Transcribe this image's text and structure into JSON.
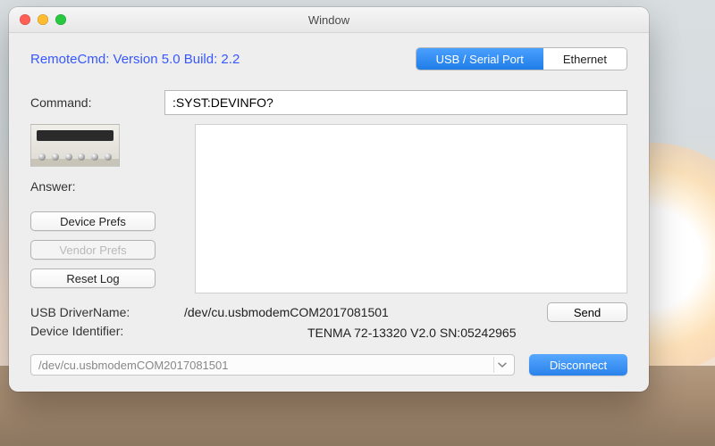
{
  "window": {
    "title": "Window"
  },
  "header": {
    "version_label": "RemoteCmd: Version 5.0 Build: 2.2",
    "tabs": {
      "usb": "USB / Serial Port",
      "ethernet": "Ethernet",
      "selected": "usb"
    }
  },
  "command": {
    "label": "Command:",
    "value": ":SYST:DEVINFO?"
  },
  "answer": {
    "label": "Answer:"
  },
  "buttons": {
    "device_prefs": "Device Prefs",
    "vendor_prefs": "Vendor Prefs",
    "reset_log": "Reset Log",
    "send": "Send",
    "disconnect": "Disconnect"
  },
  "driver": {
    "label": "USB DriverName:",
    "value": "/dev/cu.usbmodemCOM2017081501"
  },
  "device_identifier": {
    "label": "Device Identifier:",
    "value": "TENMA 72-13320 V2.0 SN:05242965"
  },
  "port_select": {
    "value": "/dev/cu.usbmodemCOM2017081501"
  }
}
